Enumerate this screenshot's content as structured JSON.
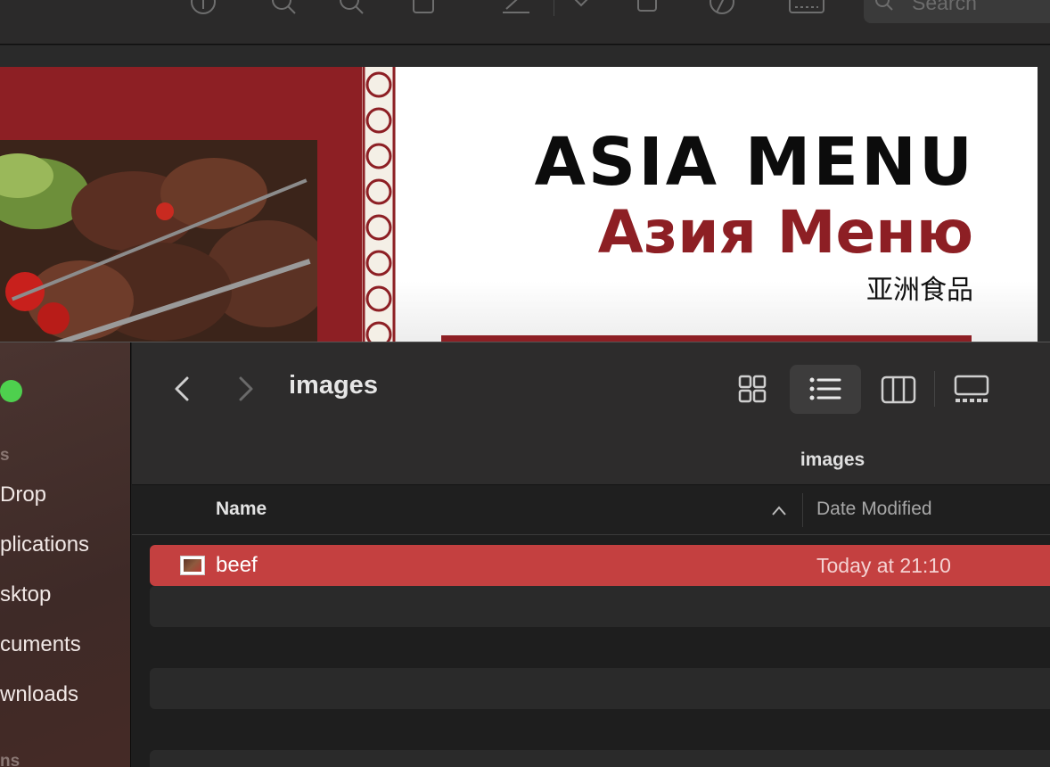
{
  "preview": {
    "search_placeholder": "Search",
    "toolbar_icons": [
      "info-icon",
      "zoom-out-icon",
      "zoom-in-icon",
      "share-icon",
      "markup-icon",
      "rotate-icon",
      "crop-icon",
      "shapes-icon",
      "sign-icon"
    ],
    "document": {
      "title_en": "ASIA MENU",
      "title_ru": "Азия Меню",
      "title_zh": "亚洲食品",
      "brand_color": "#8d1f24"
    }
  },
  "finder": {
    "window_title": "images",
    "path_title": "images",
    "sidebar": {
      "section_favorites": "s",
      "items": [
        {
          "label": "Drop"
        },
        {
          "label": "plications"
        },
        {
          "label": "sktop"
        },
        {
          "label": "cuments"
        },
        {
          "label": "wnloads"
        }
      ],
      "section_locations": "ns"
    },
    "columns": {
      "name": "Name",
      "date_modified": "Date Modified"
    },
    "files": [
      {
        "name": "beef",
        "date": "Today at 21:10",
        "selected": true
      }
    ],
    "colors": {
      "selection": "#c44040",
      "traffic_light_green": "#4ed04e"
    }
  }
}
